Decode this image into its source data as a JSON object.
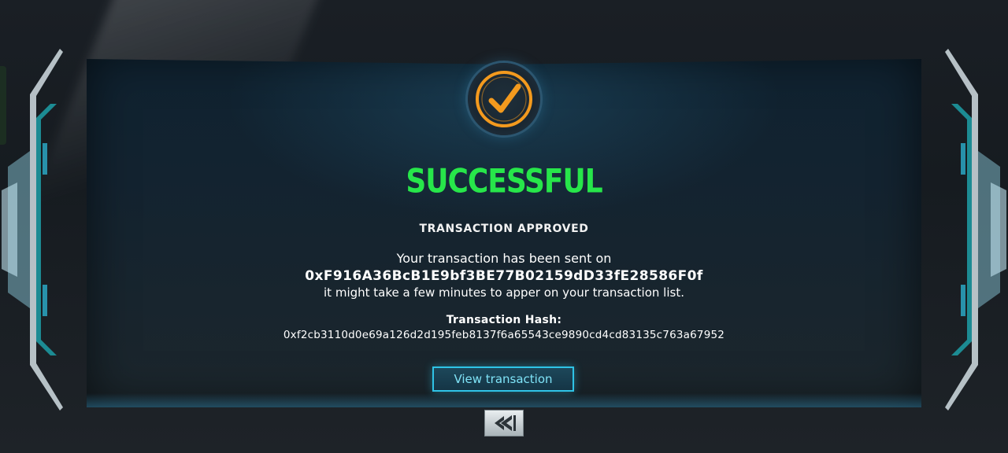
{
  "dialog": {
    "title": "SUCCESSFUL",
    "subtitle": "TRANSACTION APPROVED",
    "message_line1": "Your transaction has been sent on",
    "address": "0xF916A36BcB1E9bf3BE77B02159dD33fE28586F0f",
    "message_line3": "it might take a few minutes to apper on your transaction list.",
    "hash_label": "Transaction Hash:",
    "hash": "0xf2cb3110d0e69a126d2d195feb8137f6a65543ce9890cd4cd83135c763a67952",
    "view_button_label": "View transaction"
  },
  "icons": {
    "status": "check-icon",
    "back": "back-arrow-icon"
  },
  "colors": {
    "success": "#27e64a",
    "accent_orange": "#f39a1e",
    "accent_cyan": "#2fc3e6"
  }
}
